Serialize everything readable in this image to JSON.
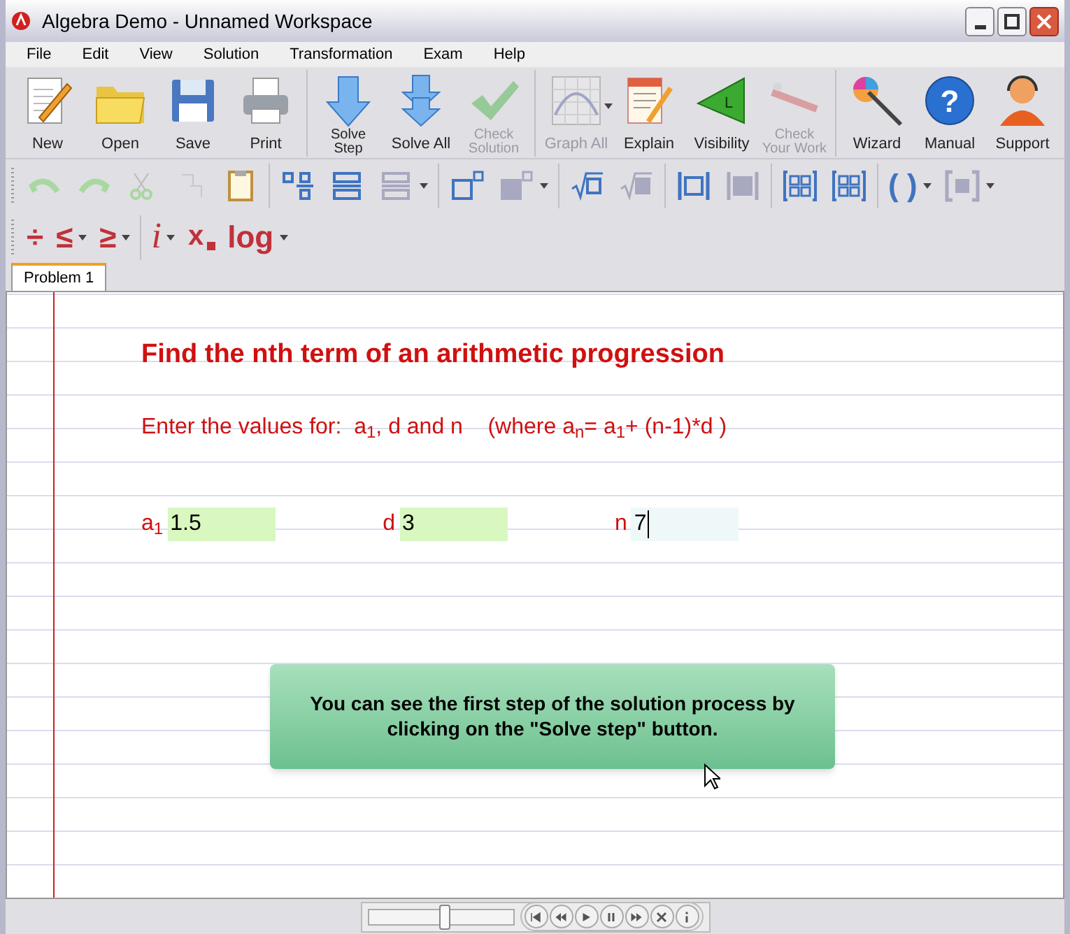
{
  "window": {
    "title": "Algebra Demo - Unnamed Workspace"
  },
  "menu": [
    "File",
    "Edit",
    "View",
    "Solution",
    "Transformation",
    "Exam",
    "Help"
  ],
  "main_toolbar": [
    [
      {
        "kind": "new",
        "label": "New",
        "disabled": false
      },
      {
        "kind": "open",
        "label": "Open",
        "disabled": false
      },
      {
        "kind": "save",
        "label": "Save",
        "disabled": false
      },
      {
        "kind": "print",
        "label": "Print",
        "disabled": false
      }
    ],
    [
      {
        "kind": "step",
        "label": "Solve\nStep",
        "disabled": false
      },
      {
        "kind": "all",
        "label": "Solve All",
        "disabled": false
      },
      {
        "kind": "check",
        "label": "Check\nSolution",
        "disabled": true
      }
    ],
    [
      {
        "kind": "graph",
        "label": "Graph All",
        "disabled": true,
        "dropdown": true
      },
      {
        "kind": "explain",
        "label": "Explain",
        "disabled": false
      },
      {
        "kind": "visibility",
        "glyph": "L",
        "label": "Visibility",
        "disabled": false
      },
      {
        "kind": "wand",
        "label": "Check\nYour Work",
        "disabled": true
      }
    ],
    [
      {
        "kind": "wizard",
        "label": "Wizard",
        "disabled": false
      },
      {
        "kind": "manual",
        "glyph": "?",
        "label": "Manual",
        "disabled": false
      },
      {
        "kind": "support",
        "label": "Support",
        "disabled": false
      }
    ]
  ],
  "format_rows": [
    [
      [
        {
          "kind": "undo",
          "disabled": true
        },
        {
          "kind": "redo",
          "disabled": true
        },
        {
          "kind": "cut",
          "disabled": true
        },
        {
          "kind": "copy",
          "disabled": true
        },
        {
          "kind": "paste",
          "disabled": false
        }
      ],
      [
        {
          "kind": "fraction",
          "disabled": false
        },
        {
          "kind": "stack",
          "disabled": false
        },
        {
          "kind": "stack",
          "disabled": true,
          "dropdown": true
        }
      ],
      [
        {
          "kind": "power",
          "disabled": false
        },
        {
          "kind": "power",
          "disabled": true,
          "dropdown": true
        }
      ],
      [
        {
          "kind": "root",
          "disabled": false
        },
        {
          "kind": "root",
          "disabled": true
        }
      ],
      [
        {
          "kind": "abs",
          "disabled": false
        },
        {
          "kind": "abs",
          "disabled": true
        }
      ],
      [
        {
          "kind": "matrix",
          "disabled": false
        },
        {
          "kind": "matrix",
          "disabled": false
        }
      ],
      [
        {
          "kind": "paren",
          "glyph": "( )",
          "disabled": false,
          "dropdown": true
        },
        {
          "kind": "bracket",
          "disabled": true,
          "dropdown": true
        }
      ]
    ],
    [
      [
        {
          "kind": "glyph",
          "glyph": "÷",
          "disabled": false
        },
        {
          "kind": "glyph",
          "glyph": "≤",
          "disabled": false,
          "dropdown": true
        },
        {
          "kind": "glyph",
          "glyph": "≥",
          "disabled": false,
          "dropdown": true
        }
      ],
      [
        {
          "kind": "italic",
          "glyph": "i",
          "disabled": false,
          "dropdown": true
        },
        {
          "kind": "subscript",
          "glyph": "x",
          "disabled": false
        },
        {
          "kind": "glyph",
          "glyph": "log",
          "disabled": false,
          "dropdown": true
        }
      ]
    ]
  ],
  "tabs": [
    {
      "label": "Problem 1",
      "selected": true
    }
  ],
  "problem": {
    "title": "Find the nth term of an arithmetic progression",
    "instruction": "Enter the values for:  a$_{1}$, d and n    (where a$_{n}$= a$_{1}$+ (n-1)*d )",
    "fields": [
      {
        "label": "a$_{1}$",
        "value": "1.5",
        "focused": false
      },
      {
        "label": "d",
        "value": "3",
        "focused": false
      },
      {
        "label": "n",
        "value": "7",
        "focused": true
      }
    ],
    "hint": "You can see the first step of the solution process by clicking on the \"Solve step\" button."
  },
  "player": {
    "level": 0.53
  }
}
